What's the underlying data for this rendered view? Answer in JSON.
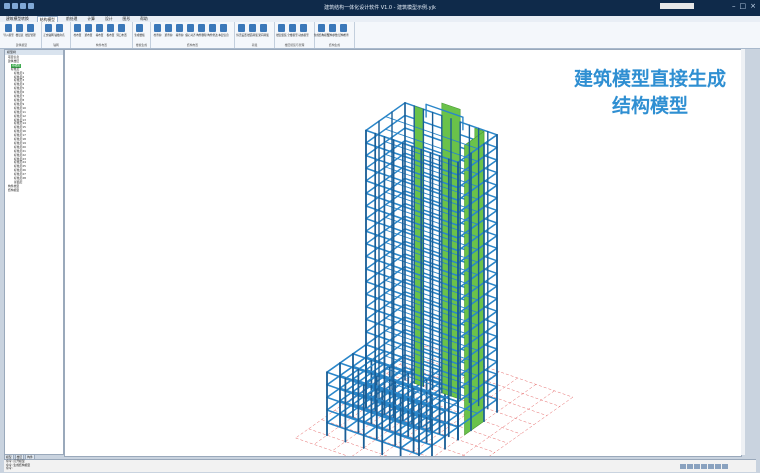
{
  "window": {
    "title": "建筑结构一体化设计软件 V1.0 - 建筑模型示例.yjk"
  },
  "menubar": {
    "items": [
      "建筑模型转换",
      "结构模型",
      "前处理",
      "计算",
      "设计",
      "图形",
      "帮助"
    ],
    "active_index": 1
  },
  "ribbon": {
    "groups": [
      {
        "label": "建筑模型",
        "buttons": [
          "导入模型",
          "楼层表",
          "楼层管理"
        ]
      },
      {
        "label": "轴网",
        "buttons": [
          "正交轴网",
          "轴线命名"
        ]
      },
      {
        "label": "构件布置",
        "buttons": [
          "柱布置",
          "梁布置",
          "墙布置",
          "板布置",
          "洞口布置"
        ]
      },
      {
        "label": "楼板生成",
        "buttons": [
          "生成楼板"
        ]
      },
      {
        "label": "结构布置",
        "buttons": [
          "柱查询",
          "梁查询",
          "墙查询",
          "偏心对齐",
          "构件删除",
          "构件修改",
          "本层信息"
        ]
      },
      {
        "label": "荷载",
        "buttons": [
          "恒活设置",
          "楼面荷载",
          "梁间荷载"
        ]
      },
      {
        "label": "楼层组装与管理",
        "buttons": [
          "楼层组装",
          "全楼模型",
          "动态模型"
        ]
      },
      {
        "label": "结构生成",
        "buttons": [
          "生成结构模型",
          "结构参数",
          "结构检查"
        ]
      }
    ]
  },
  "left_panel": {
    "title": "模型树",
    "items": [
      "项目信息",
      "建筑楼层",
      "基础层",
      "标准层",
      "标准层1",
      "标准层2",
      "标准层3",
      "标准层4",
      "标准层5",
      "标准层6",
      "标准层7",
      "标准层8",
      "标准层9",
      "标准层10",
      "标准层11",
      "标准层12",
      "标准层13",
      "标准层14",
      "标准层15",
      "标准层16",
      "标准层17",
      "标准层18",
      "标准层19",
      "标准层20",
      "标准层21",
      "标准层22",
      "标准层23",
      "标准层24",
      "标准层25",
      "标准层26",
      "标准层27",
      "标准层28",
      "屋面层",
      "构件类型",
      "结构模型"
    ],
    "selected_index": 2,
    "tabs": [
      "模型",
      "楼层",
      "构件"
    ]
  },
  "canvas": {
    "overlay_line1": "建筑模型直接生成",
    "overlay_line2": "结构模型",
    "colors": {
      "frame": "#2a86c9",
      "frame_dark": "#1a5e96",
      "core": "#6ac24a",
      "grid": "#e66b6b",
      "overlay_text": "#2f8fd2"
    }
  },
  "command": {
    "lines": [
      "命令: 打开模型",
      "命令: 生成结构模型",
      "命令:"
    ]
  }
}
